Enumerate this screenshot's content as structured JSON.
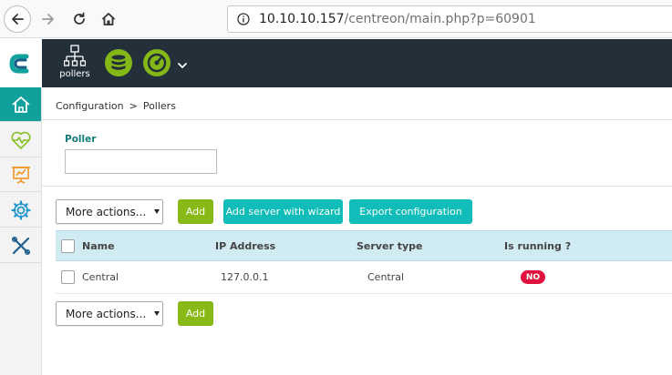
{
  "browser": {
    "url_host": "10.10.10.157",
    "url_path": "/centreon/main.php?p=60901"
  },
  "header": {
    "pollers_label": "pollers"
  },
  "breadcrumb": {
    "parent": "Configuration",
    "separator": ">",
    "current": "Pollers"
  },
  "filter": {
    "label": "Poller",
    "value": ""
  },
  "toolbar": {
    "more_actions_label": "More actions...",
    "add_label": "Add",
    "wizard_label": "Add server with wizard",
    "export_label": "Export configuration"
  },
  "table": {
    "columns": [
      "Name",
      "IP Address",
      "Server type",
      "Is running ?"
    ],
    "rows": [
      {
        "name": "Central",
        "ip": "127.0.0.1",
        "server_type": "Central",
        "is_running": "NO"
      }
    ]
  },
  "colors": {
    "accent": "#10a19d",
    "add_green": "#88b917",
    "teal_button": "#10bdb8",
    "status_no": "#e0113d",
    "header_bg": "#232f39"
  }
}
